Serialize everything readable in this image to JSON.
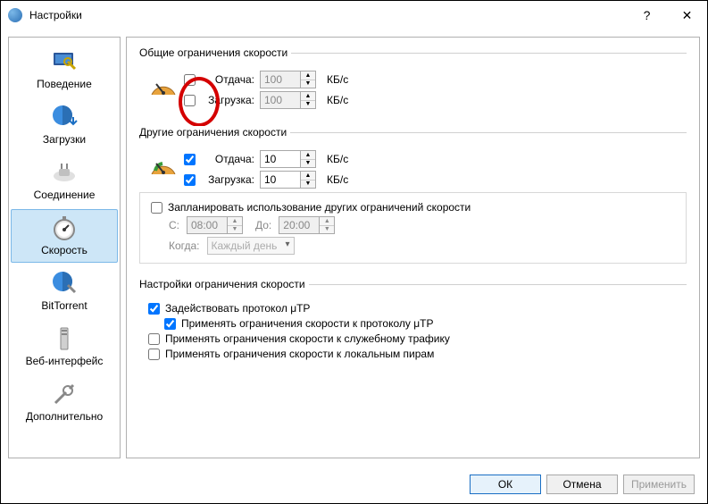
{
  "window": {
    "title": "Настройки"
  },
  "titlebar_buttons": {
    "help": "?",
    "close": "✕"
  },
  "sidebar": {
    "items": [
      {
        "label": "Поведение"
      },
      {
        "label": "Загрузки"
      },
      {
        "label": "Соединение"
      },
      {
        "label": "Скорость"
      },
      {
        "label": "BitTorrent"
      },
      {
        "label": "Веб-интерфейс"
      },
      {
        "label": "Дополнительно"
      }
    ]
  },
  "global_limits": {
    "legend": "Общие ограничения скорости",
    "upload": {
      "label": "Отдача:",
      "value": "100",
      "unit": "КБ/с",
      "checked": false
    },
    "download": {
      "label": "Загрузка:",
      "value": "100",
      "unit": "КБ/с",
      "checked": false
    }
  },
  "alt_limits": {
    "legend": "Другие ограничения скорости",
    "upload": {
      "label": "Отдача:",
      "value": "10",
      "unit": "КБ/с",
      "checked": true
    },
    "download": {
      "label": "Загрузка:",
      "value": "10",
      "unit": "КБ/с",
      "checked": true
    },
    "schedule": {
      "label": "Запланировать использование других ограничений скорости",
      "checked": false,
      "from_label": "С:",
      "from": "08:00",
      "to_label": "До:",
      "to": "20:00",
      "when_label": "Когда:",
      "when_value": "Каждый день"
    }
  },
  "limit_settings": {
    "legend": "Настройки ограничения скорости",
    "utp": {
      "label": "Задействовать протокол μTP",
      "checked": true
    },
    "utp_limits": {
      "label": "Применять ограничения скорости к протоколу μTP",
      "checked": true
    },
    "overhead": {
      "label": "Применять ограничения скорости к служебному трафику",
      "checked": false
    },
    "lan": {
      "label": "Применять ограничения скорости к локальным пирам",
      "checked": false
    }
  },
  "buttons": {
    "ok": "ОК",
    "cancel": "Отмена",
    "apply": "Применить"
  }
}
